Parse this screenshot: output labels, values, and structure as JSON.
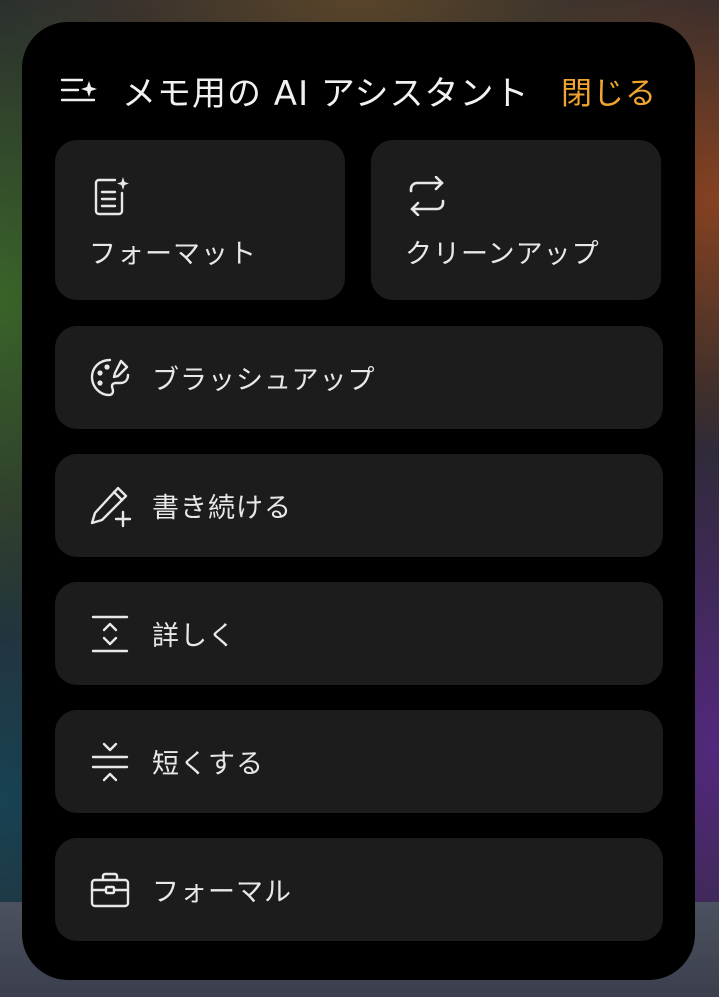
{
  "header": {
    "title": "メモ用の AI アシスタント",
    "close_label": "閉じる",
    "menu_icon": "menu-sparkle-icon"
  },
  "colors": {
    "panel_bg": "#000000",
    "tile_bg": "#1c1c1c",
    "text": "#e8e8e8",
    "accent": "#f0a52e"
  },
  "actions": [
    {
      "label": "フォーマット",
      "icon": "format-document-icon"
    },
    {
      "label": "クリーンアップ",
      "icon": "swap-arrows-icon"
    },
    {
      "label": "ブラッシュアップ",
      "icon": "palette-icon"
    },
    {
      "label": "書き続ける",
      "icon": "pen-plus-icon"
    },
    {
      "label": "詳しく",
      "icon": "expand-vertical-icon"
    },
    {
      "label": "短くする",
      "icon": "collapse-vertical-icon"
    },
    {
      "label": "フォーマル",
      "icon": "briefcase-icon"
    }
  ]
}
